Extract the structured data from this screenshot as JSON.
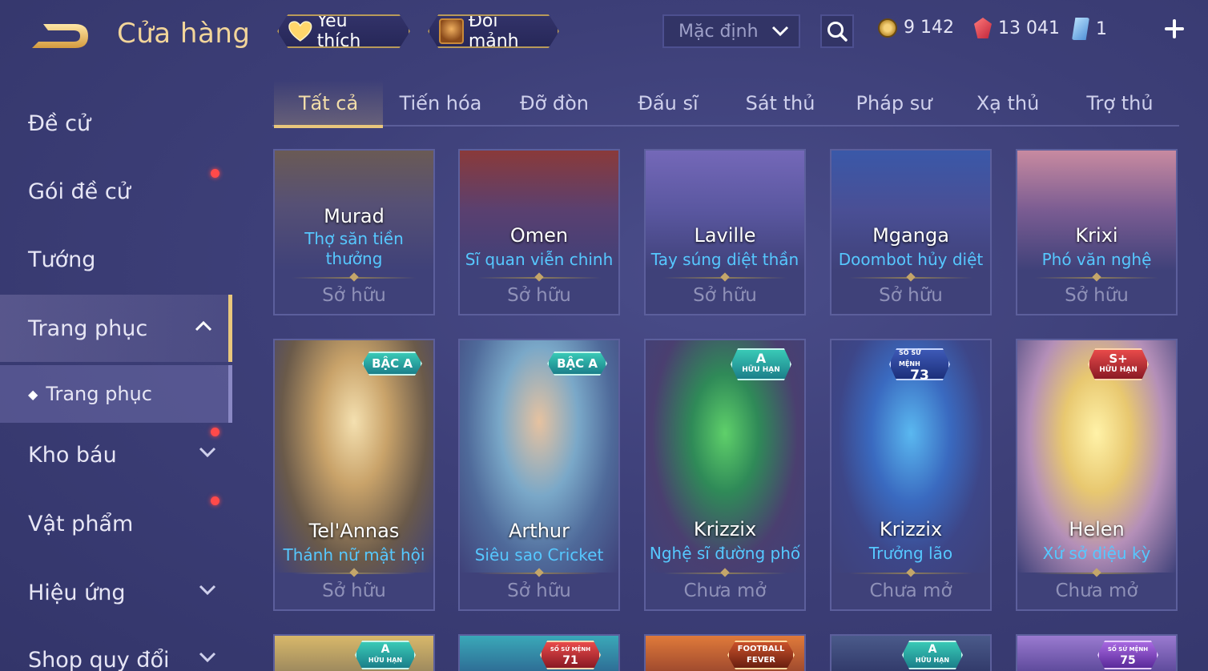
{
  "header": {
    "title": "Cửa hàng",
    "favorites_label": "Yêu thích",
    "exchange_label": "Đổi mảnh",
    "sort_value": "Mặc định"
  },
  "currencies": {
    "gold": "9 142",
    "voucher": "13 041",
    "gem": "1"
  },
  "sidebar": {
    "items": [
      {
        "label": "Đề cử"
      },
      {
        "label": "Gói đề cử"
      },
      {
        "label": "Tướng"
      },
      {
        "label": "Trang phục"
      },
      {
        "label": "Trang phục"
      },
      {
        "label": "Kho báu"
      },
      {
        "label": "Vật phẩm"
      },
      {
        "label": "Hiệu ứng"
      },
      {
        "label": "Shop quy đổi"
      }
    ]
  },
  "tabs": [
    "Tất cả",
    "Tiến hóa",
    "Đỡ đòn",
    "Đấu sĩ",
    "Sát thủ",
    "Pháp sư",
    "Xạ thủ",
    "Trợ thủ"
  ],
  "active_tab": "Tất cả",
  "cards": [
    {
      "hero": "Murad",
      "skin": "Thợ săn tiền thưởng",
      "status": "Sở hữu"
    },
    {
      "hero": "Omen",
      "skin": "Sĩ quan viễn chinh",
      "status": "Sở hữu"
    },
    {
      "hero": "Laville",
      "skin": "Tay súng diệt thần",
      "status": "Sở hữu"
    },
    {
      "hero": "Mganga",
      "skin": "Doombot hủy diệt",
      "status": "Sở hữu"
    },
    {
      "hero": "Krixi",
      "skin": "Phó văn nghệ",
      "status": "Sở hữu"
    },
    {
      "hero": "Tel'Annas",
      "skin": "Thánh nữ mật hội",
      "status": "Sở hữu",
      "badge": "BẬC A"
    },
    {
      "hero": "Arthur",
      "skin": "Siêu sao Cricket",
      "status": "Sở hữu",
      "badge": "BẬC A"
    },
    {
      "hero": "Krizzix",
      "skin": "Nghệ sĩ đường phố",
      "status": "Chưa mở",
      "badge": "A",
      "badge_sub": "HỮU HẠN"
    },
    {
      "hero": "Krizzix",
      "skin": "Trưởng lão",
      "status": "Chưa mở",
      "badge": "73",
      "badge_sub": "SỐ SỨ MỆNH"
    },
    {
      "hero": "Helen",
      "skin": "Xứ sở diệu kỳ",
      "status": "Chưa mở",
      "badge": "S+",
      "badge_sub": "HỮU HẠN"
    }
  ],
  "bottom_badges": [
    {
      "top": "A",
      "sub": "HỮU HẠN"
    },
    {
      "top": "71",
      "sub": "SỐ SỨ MỆNH"
    },
    {
      "top": "FOOTBALL",
      "sub": "FEVER"
    },
    {
      "top": "A",
      "sub": "HỮU HẠN"
    },
    {
      "top": "75",
      "sub": "SỐ SỨ MỆNH"
    }
  ]
}
